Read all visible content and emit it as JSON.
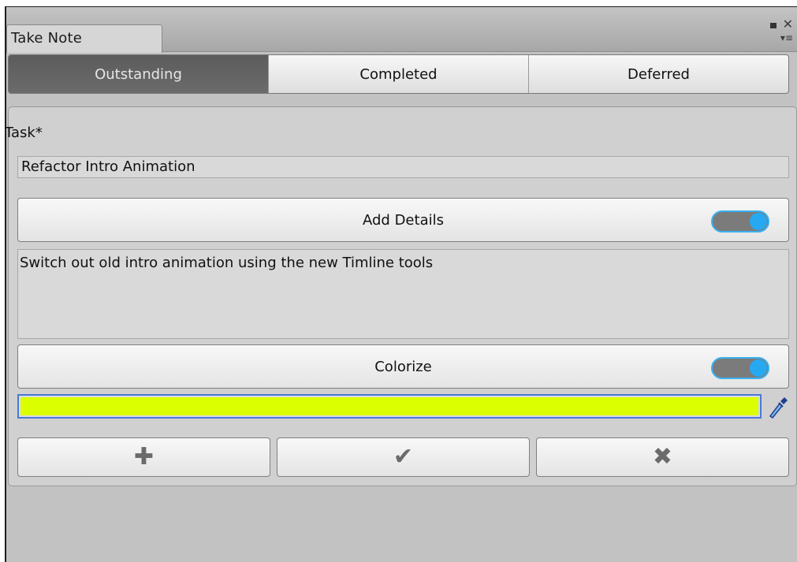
{
  "window": {
    "title": "Take Note",
    "controls": {
      "maximize_icon": "maximize-icon",
      "close_icon": "close-icon",
      "close_glyph": "✕",
      "menu_glyph": "▾≡"
    }
  },
  "tabs": {
    "items": [
      {
        "label": "Outstanding",
        "active": true
      },
      {
        "label": "Completed",
        "active": false
      },
      {
        "label": "Deferred",
        "active": false
      }
    ]
  },
  "form": {
    "task_label": "Task*",
    "task_value": "Refactor Intro Animation",
    "details_button": "Add Details",
    "details_toggle_on": true,
    "details_text": "Switch out old intro animation using the new Timline tools",
    "colorize_button": "Colorize",
    "colorize_toggle_on": true,
    "color_value": "#dcff00",
    "accent_color": "#27a9f2"
  },
  "actions": {
    "add_glyph": "✚",
    "complete_glyph": "✔",
    "delete_glyph": "✖"
  }
}
